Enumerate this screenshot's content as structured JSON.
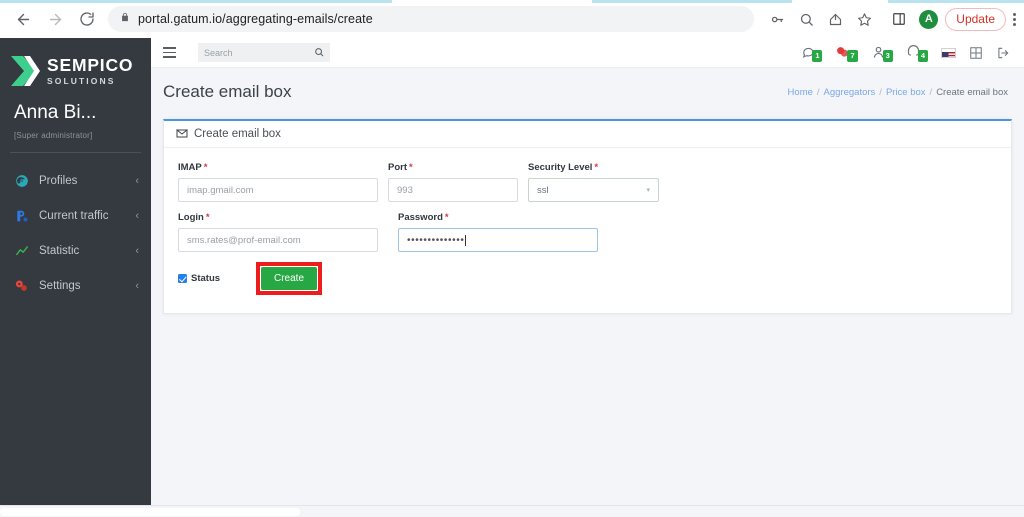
{
  "browser": {
    "url": "portal.gatum.io/aggregating-emails/create",
    "back_icon": "back-arrow-icon",
    "forward_icon": "forward-arrow-icon",
    "reload_icon": "reload-icon",
    "lock_icon": "lock-icon",
    "password_icon": "key-icon",
    "search_icon": "search-icon",
    "share_icon": "share-icon",
    "bookmark_icon": "star-icon",
    "sidepanel_icon": "side-panel-icon",
    "profile_initial": "A",
    "update_label": "Update",
    "menu_icon": "kebab-menu-icon"
  },
  "sidebar": {
    "brand": "SEMPICO",
    "brand_sub": "SOLUTIONS",
    "user_name": "Anna Bi...",
    "user_role": "[Super administrator]",
    "items": [
      {
        "label": "Profiles",
        "icon": "profiles-icon",
        "color": "#2aa9b8"
      },
      {
        "label": "Current traffic",
        "icon": "traffic-icon",
        "color": "#2f7ae5"
      },
      {
        "label": "Statistic",
        "icon": "statistic-icon",
        "color": "#39b54a"
      },
      {
        "label": "Settings",
        "icon": "settings-icon",
        "color": "#e8453c"
      }
    ]
  },
  "header": {
    "hamburger_icon": "hamburger-menu-icon",
    "search_placeholder": "Search",
    "search_icon": "search-icon",
    "icons": [
      {
        "name": "chat-icon",
        "badge": "1"
      },
      {
        "name": "notifications-icon",
        "badge": "7"
      },
      {
        "name": "users-icon",
        "badge": "3"
      },
      {
        "name": "support-icon",
        "badge": "4"
      }
    ],
    "flag": "us-flag-icon",
    "grid_icon": "apps-grid-icon",
    "logout_icon": "logout-icon"
  },
  "page": {
    "title": "Create email box",
    "breadcrumb": [
      {
        "label": "Home",
        "link": true
      },
      {
        "label": "Aggregators",
        "link": true
      },
      {
        "label": "Price box",
        "link": true
      },
      {
        "label": "Create email box",
        "link": false
      }
    ],
    "separator": "/"
  },
  "card": {
    "icon": "envelope-icon",
    "title": "Create email box",
    "fields": {
      "imap": {
        "label": "IMAP",
        "required": "*",
        "value": "imap.gmail.com"
      },
      "port": {
        "label": "Port",
        "required": "*",
        "value": "993"
      },
      "security": {
        "label": "Security Level",
        "required": "*",
        "value": "ssl",
        "caret": "▾"
      },
      "login": {
        "label": "Login",
        "required": "*",
        "value": "sms.rates@prof-email.com"
      },
      "password": {
        "label": "Password",
        "required": "*",
        "value": "••••••••••••••"
      }
    },
    "status_label": "Status",
    "submit_label": "Create"
  },
  "colors": {
    "accent_blue": "#4a96e2",
    "success_green": "#28a745",
    "highlight_red": "#ee1c1c",
    "sidebar_dark": "#343a40",
    "required_red": "#dc3545"
  }
}
